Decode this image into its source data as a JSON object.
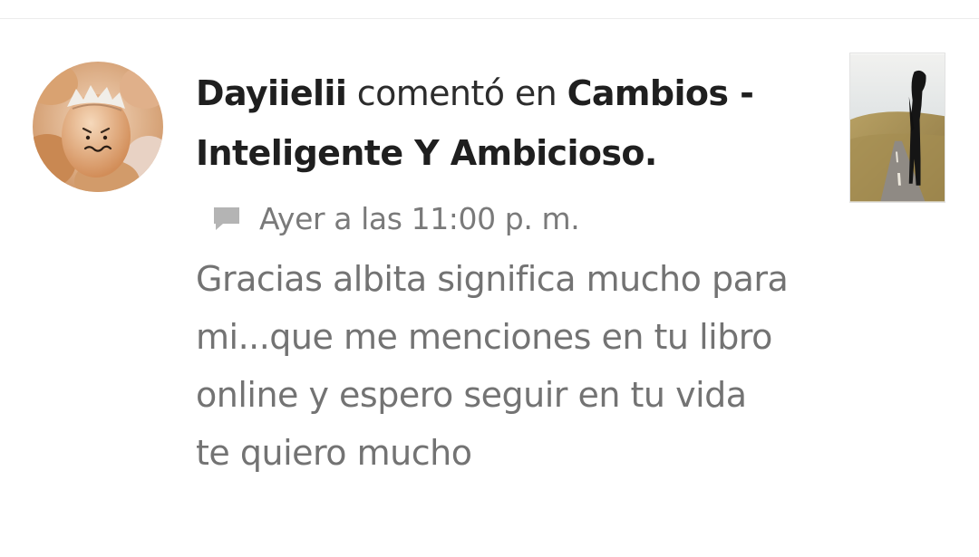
{
  "notification": {
    "user_name": "Dayiielii",
    "verb": "comentó en",
    "story_title": "Cambios - Inteligente Y Ambicioso.",
    "timestamp": "Ayer a las 11:00 p. m.",
    "comment_text": "Gracias albita significa mucho para mi...que me menciones en tu libro online y espero seguir en tu vida\nte quiero mucho",
    "avatar_icon": "egg-face-avatar",
    "meta_icon": "comment-icon",
    "cover_icon": "story-cover-thumbnail"
  },
  "colors": {
    "name_text": "#1f1f1f",
    "timestamp_text": "#7a7a7a",
    "body_text": "#737373",
    "icon_gray": "#b4b4b4",
    "divider": "#ececec"
  }
}
